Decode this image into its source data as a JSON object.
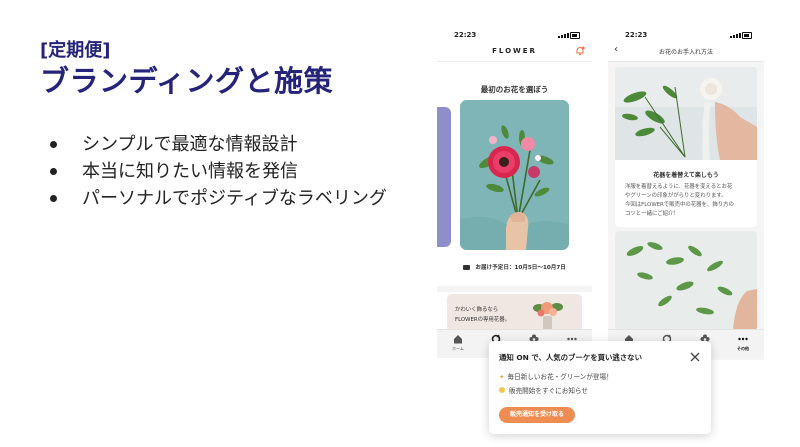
{
  "slide": {
    "tag": "[定期便]",
    "title": "ブランディングと施策",
    "bullets": [
      "シンプルで最適な情報設計",
      "本当に知りたい情報を発信",
      "パーソナルでポジティブなラベリング"
    ]
  },
  "phone1": {
    "time": "22:23",
    "logo": "FLOWER",
    "section_title": "最初のお花を選ぼう",
    "delivery_icon": "truck-icon",
    "delivery_text": "お届け予定日：10月5日〜10月7日",
    "promo_line1": "かわいく飾るなら",
    "promo_line2": "FLOWERの専用花器。",
    "tabs": [
      {
        "label": "ホーム",
        "icon": "home-icon"
      },
      {
        "label": "",
        "icon": "refresh-icon"
      },
      {
        "label": "",
        "icon": "flower-icon"
      },
      {
        "label": "",
        "icon": "more-icon"
      }
    ]
  },
  "phone2": {
    "time": "22:23",
    "header_title": "お花のお手入れ方法",
    "card_title": "花器を着替えて楽しもう",
    "card_body": [
      "洋服を着替えるように、花器を変えるとお花",
      "やグリーンの印象ががらりと変わります。",
      "今回はFLOWERで販売中の花器を、飾り方の",
      "コツと一緒にご紹介！"
    ],
    "tabs": [
      {
        "label": "",
        "icon": "home-icon"
      },
      {
        "label": "",
        "icon": "refresh-icon"
      },
      {
        "label": "",
        "icon": "flower-icon"
      },
      {
        "label": "その他",
        "icon": "more-icon"
      }
    ]
  },
  "notification": {
    "title": "通知 ON で、人気のブーケを買い逃さない",
    "items": [
      {
        "icon": "sparkle-icon",
        "text": "毎日新しいお花・グリーンが登場！"
      },
      {
        "icon": "bulb-icon",
        "text": "販売開始をすぐにお知らせ"
      }
    ],
    "button_label": "販売通知を受け取る"
  },
  "colors": {
    "title_navy": "#26247a",
    "accent_orange": "#ee8d52",
    "card_teal": "#7fb5b6"
  }
}
